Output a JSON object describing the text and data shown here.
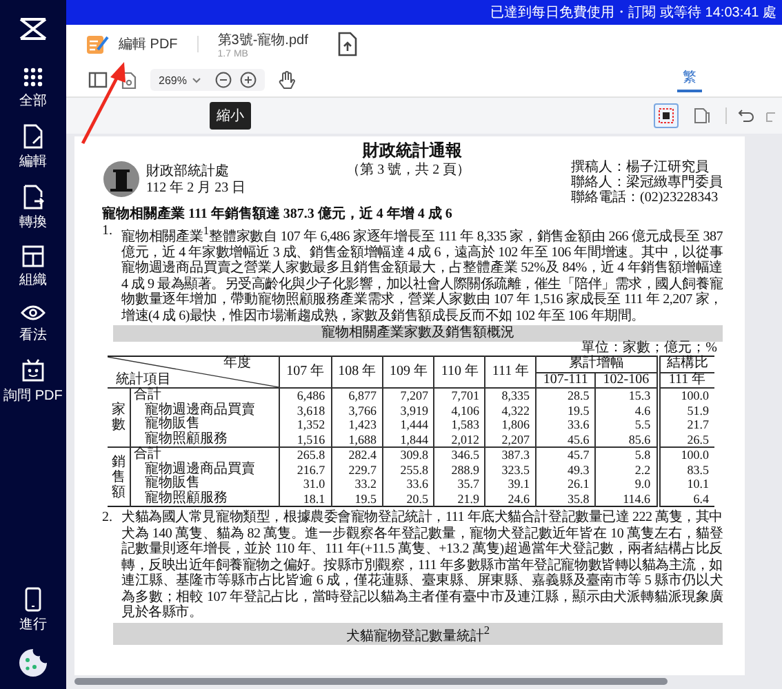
{
  "banner": {
    "text": "已達到每日免費使用・訂閱 或等待 14:03:41 處"
  },
  "sidebar": {
    "items": [
      {
        "label": "全部"
      },
      {
        "label": "編輯"
      },
      {
        "label": "轉換"
      },
      {
        "label": "組織"
      },
      {
        "label": "看法"
      },
      {
        "label": "詢問 PDF"
      }
    ],
    "bottom_item": {
      "label": "進行"
    }
  },
  "header": {
    "app_tab": "編輯 PDF",
    "file": {
      "name": "第3號-寵物.pdf",
      "size": "1.7 MB"
    }
  },
  "toolbar": {
    "zoom": "269%",
    "tabs": [
      {
        "label": "繁",
        "selected": true
      }
    ],
    "tooltip": "縮小"
  },
  "tools": [
    {
      "selected": true
    },
    {
      "selected": false
    }
  ],
  "document": {
    "title": "財政統計通報",
    "subtitle": "（第 3 號，共 2 頁）",
    "org": "財政部統計處",
    "date": "112 年 2 月 23 日",
    "contacts": [
      "撰稿人：楊子江研究員",
      "聯絡人：梁冠緻專門委員",
      "聯絡電話：(02)23228343"
    ],
    "heading": "寵物相關產業 111 年銷售額達 387.3 億元，近 4 年增 4 成 6",
    "paragraphs": [
      {
        "number": "1.",
        "text": "寵物相關產業$^{1}$整體家數自 107 年 6,486 家逐年增長至 111 年 8,335 家，銷售金額由 266 億元成長至 387 億元，近 4 年家數增幅近 3 成、銷售金額增幅達 4 成 6，遠高於 102 年至 106 年間增速。其中，以從事寵物週邊商品買賣之營業人家數最多且銷售金額最大，占整體產業 52%及 84%，近 4 年銷售額增幅達 4 成 9 最為顯著。另受高齡化與少子化影響，加以社會人際關係疏離，催生「陪伴」需求，國人飼養寵物數量逐年增加，帶動寵物照顧服務產業需求，營業人家數由 107 年 1,516 家成長至 111 年 2,207 家，增速(4 成 6)最快，惟因市場漸趨成熟，家數及銷售額成長反而不如 102 年至 106 年期間。"
      }
    ],
    "table": {
      "caption": "寵物相關產業家數及銷售額概況",
      "unit": "單位：家數；億元；%",
      "corner_top": "年度",
      "corner_bottom": "統計項目",
      "years": [
        "107 年",
        "108 年",
        "109 年",
        "110 年",
        "111 年"
      ],
      "growth_header": "累計增幅",
      "growth_columns": [
        "107-111",
        "102-106"
      ],
      "share_header": "結構比",
      "share_column": "111 年",
      "groups": [
        {
          "name": "家數",
          "rows": [
            {
              "label": "合計",
              "values": [
                "6,486",
                "6,877",
                "7,207",
                "7,701",
                "8,335",
                "28.5",
                "15.3",
                "100.0"
              ]
            },
            {
              "label": "寵物週邊商品買賣",
              "values": [
                "3,618",
                "3,766",
                "3,919",
                "4,106",
                "4,322",
                "19.5",
                "4.6",
                "51.9"
              ]
            },
            {
              "label": "寵物販售",
              "values": [
                "1,352",
                "1,423",
                "1,444",
                "1,583",
                "1,806",
                "33.6",
                "5.5",
                "21.7"
              ]
            },
            {
              "label": "寵物照顧服務",
              "values": [
                "1,516",
                "1,688",
                "1,844",
                "2,012",
                "2,207",
                "45.6",
                "85.6",
                "26.5"
              ]
            }
          ]
        },
        {
          "name": "銷售額",
          "rows": [
            {
              "label": "合計",
              "values": [
                "265.8",
                "282.4",
                "309.8",
                "346.5",
                "387.3",
                "45.7",
                "5.8",
                "100.0"
              ]
            },
            {
              "label": "寵物週邊商品買賣",
              "values": [
                "216.7",
                "229.7",
                "255.8",
                "288.9",
                "323.5",
                "49.3",
                "2.2",
                "83.5"
              ]
            },
            {
              "label": "寵物販售",
              "values": [
                "31.0",
                "33.2",
                "33.6",
                "35.7",
                "39.1",
                "26.1",
                "9.0",
                "10.1"
              ]
            },
            {
              "label": "寵物照顧服務",
              "values": [
                "18.1",
                "19.5",
                "20.5",
                "21.9",
                "24.6",
                "35.8",
                "114.6",
                "6.4"
              ]
            }
          ]
        }
      ]
    },
    "paragraphs_2": [
      {
        "number": "2.",
        "text": "犬貓為國人常見寵物類型，根據農委會寵物登記統計，111 年底犬貓合計登記數量已達 222 萬隻，其中犬為 140 萬隻、貓為 82 萬隻。進一步觀察各年登記數量，寵物犬登記數近年皆在 10 萬隻左右，貓登記數量則逐年增長，並於 110 年、111 年(+11.5 萬隻、+13.2 萬隻)超過當年犬登記數，兩者結構占比反轉，反映出近年飼養寵物之偏好。按縣市別觀察，111 年多數縣市當年登記寵物數皆轉以貓為主流，如連江縣、基隆市等縣市占比皆逾 6 成，僅花蓮縣、臺東縣、屏東縣、嘉義縣及臺南市等 5 縣市仍以犬為多數；相較 107 年登記占比，當時登記以貓為主者僅有臺中市及連江縣，顯示由犬派轉貓派現象廣見於各縣市。"
      }
    ],
    "caption_2": "犬貓寵物登記數量統計$^{2}$"
  }
}
